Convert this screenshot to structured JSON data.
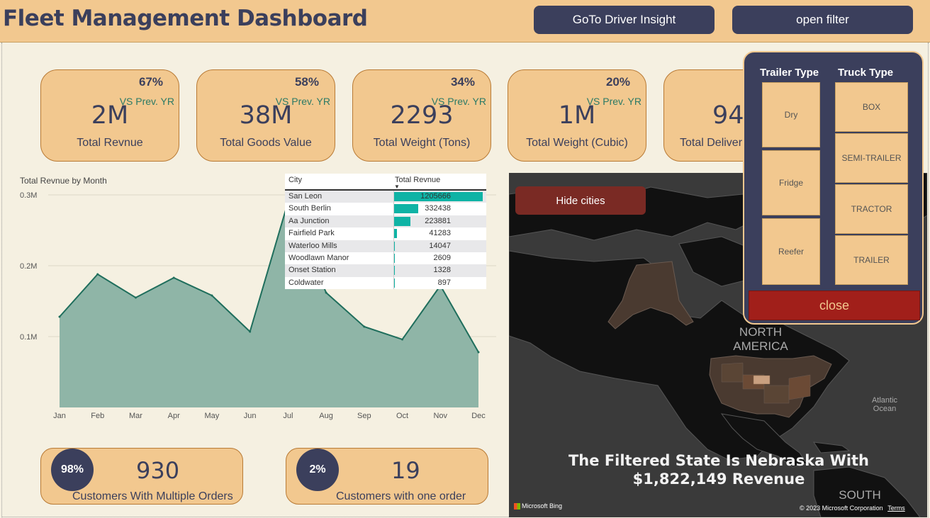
{
  "header": {
    "title": "Fleet Management Dashboard",
    "btn_driver": "GoTo Driver Insight",
    "btn_filter": "open filter"
  },
  "kpis": [
    {
      "pct": "67%",
      "vs": "VS Prev. YR",
      "value": "2M",
      "label": "Total Revnue"
    },
    {
      "pct": "58%",
      "vs": "VS Prev. YR",
      "value": "38M",
      "label": "Total Goods Value"
    },
    {
      "pct": "34%",
      "vs": "VS Prev. YR",
      "value": "2293",
      "label": "Total Weight (Tons)"
    },
    {
      "pct": "20%",
      "vs": "VS Prev. YR",
      "value": "1M",
      "label": "Total Weight (Cubic)"
    },
    {
      "pct": "",
      "vs": "",
      "value": "94",
      "label": "Total Deliver"
    }
  ],
  "chart_data": {
    "type": "area",
    "title": "Total Revnue by Month",
    "categories": [
      "Jan",
      "Feb",
      "Mar",
      "Apr",
      "May",
      "Jun",
      "Jul",
      "Aug",
      "Sep",
      "Oct",
      "Nov",
      "Dec"
    ],
    "values": [
      128000,
      188000,
      155000,
      183000,
      158000,
      107000,
      290000,
      162000,
      114000,
      96000,
      172000,
      78000
    ],
    "yticks": [
      "0.1M",
      "0.2M",
      "0.3M"
    ],
    "ylim": [
      0,
      300000
    ],
    "grid": true,
    "colors": {
      "fill": "#8fb5a7",
      "line": "#1f6e5c"
    }
  },
  "city_table": {
    "headers": [
      "City",
      "Total Revnue"
    ],
    "max": 1205666,
    "rows": [
      {
        "city": "San Leon",
        "revenue": 1205666
      },
      {
        "city": "South Berlin",
        "revenue": 332438
      },
      {
        "city": "Aa Junction",
        "revenue": 223881
      },
      {
        "city": "Fairfield Park",
        "revenue": 41283
      },
      {
        "city": "Waterloo Mills",
        "revenue": 14047
      },
      {
        "city": "Woodlawn Manor",
        "revenue": 2609
      },
      {
        "city": "Onset Station",
        "revenue": 1328
      },
      {
        "city": "Coldwater",
        "revenue": 897
      }
    ]
  },
  "map": {
    "hide_cities": "Hide cities",
    "label_na": "NORTH\nAMERICA",
    "label_ocean": "Atlantic\nOcean",
    "label_sa": "SOUTH",
    "message_line1": "The Filtered State Is Nebraska With",
    "message_line2": "$1,822,149 Revenue",
    "bing": "Microsoft Bing",
    "copyright": "© 2023 Microsoft Corporation",
    "terms": "Terms"
  },
  "customers": [
    {
      "pct": "98%",
      "value": "930",
      "label": "Customers With Multiple Orders"
    },
    {
      "pct": "2%",
      "value": "19",
      "label": "Customers with one order"
    }
  ],
  "filter_panel": {
    "trailer_title": "Trailer Type",
    "truck_title": "Truck Type",
    "trailer_types": [
      "Dry",
      "Fridge",
      "Reefer"
    ],
    "truck_types": [
      "BOX",
      "SEMI-TRAILER",
      "TRACTOR",
      "TRAILER"
    ],
    "close": "close"
  }
}
